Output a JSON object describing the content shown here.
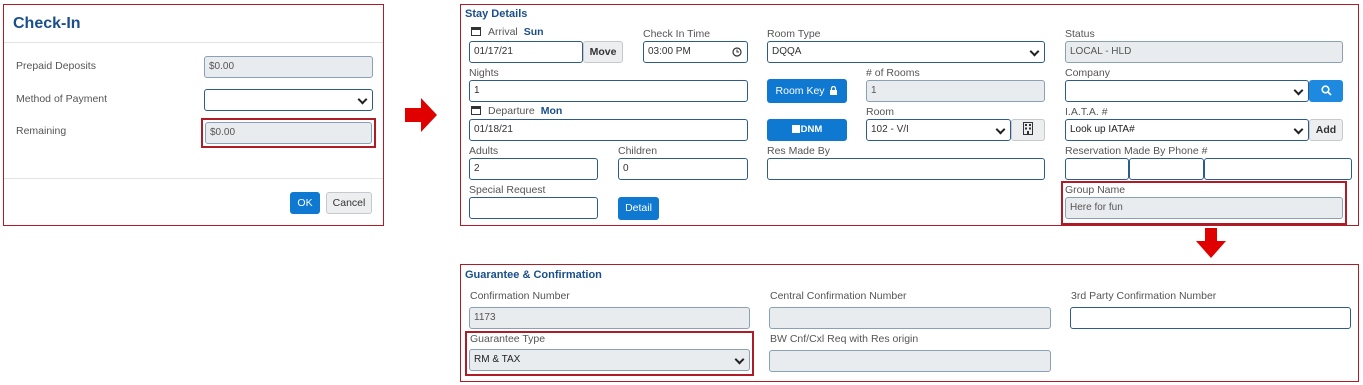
{
  "checkin": {
    "title": "Check-In",
    "prepaid_label": "Prepaid Deposits",
    "prepaid_value": "$0.00",
    "method_label": "Method of Payment",
    "method_value": "",
    "remaining_label": "Remaining",
    "remaining_value": "$0.00",
    "ok_label": "OK",
    "cancel_label": "Cancel"
  },
  "stay": {
    "title": "Stay Details",
    "arrival_label": "Arrival",
    "arrival_day": "Sun",
    "arrival_value": "01/17/21",
    "move_label": "Move",
    "checkin_time_label": "Check In Time",
    "checkin_time_value": "03:00 PM",
    "room_type_label": "Room Type",
    "room_type_value": "DQQA",
    "status_label": "Status",
    "status_value": "LOCAL - HLD",
    "nights_label": "Nights",
    "nights_value": "1",
    "room_key_label": "Room Key",
    "rooms_count_label": "# of Rooms",
    "rooms_count_value": "1",
    "company_label": "Company",
    "company_value": "",
    "departure_label": "Departure",
    "departure_day": "Mon",
    "departure_value": "01/18/21",
    "dnm_label": "DNM",
    "room_label": "Room",
    "room_value": "102 - V/I",
    "iata_label": "I.A.T.A. #",
    "iata_value": "Look up IATA#",
    "add_label": "Add",
    "adults_label": "Adults",
    "adults_value": "2",
    "children_label": "Children",
    "children_value": "0",
    "res_made_by_label": "Res Made By",
    "res_made_by_value": "",
    "res_phone_label": "Reservation Made By Phone #",
    "special_request_label": "Special Request",
    "special_request_value": "",
    "detail_label": "Detail",
    "group_name_label": "Group Name",
    "group_name_value": "Here for fun"
  },
  "guarantee": {
    "title": "Guarantee & Confirmation",
    "conf_label": "Confirmation Number",
    "conf_value": "1173",
    "central_conf_label": "Central Confirmation Number",
    "central_conf_value": "",
    "third_party_label": "3rd Party Confirmation Number",
    "third_party_value": "",
    "guarantee_type_label": "Guarantee Type",
    "guarantee_type_value": "RM & TAX",
    "bw_label": "BW Cnf/Cxl Req with Res origin",
    "bw_value": ""
  },
  "colors": {
    "highlight": "#b01c26",
    "heading": "#1a4f8a",
    "primary_button": "#0f78d1"
  }
}
